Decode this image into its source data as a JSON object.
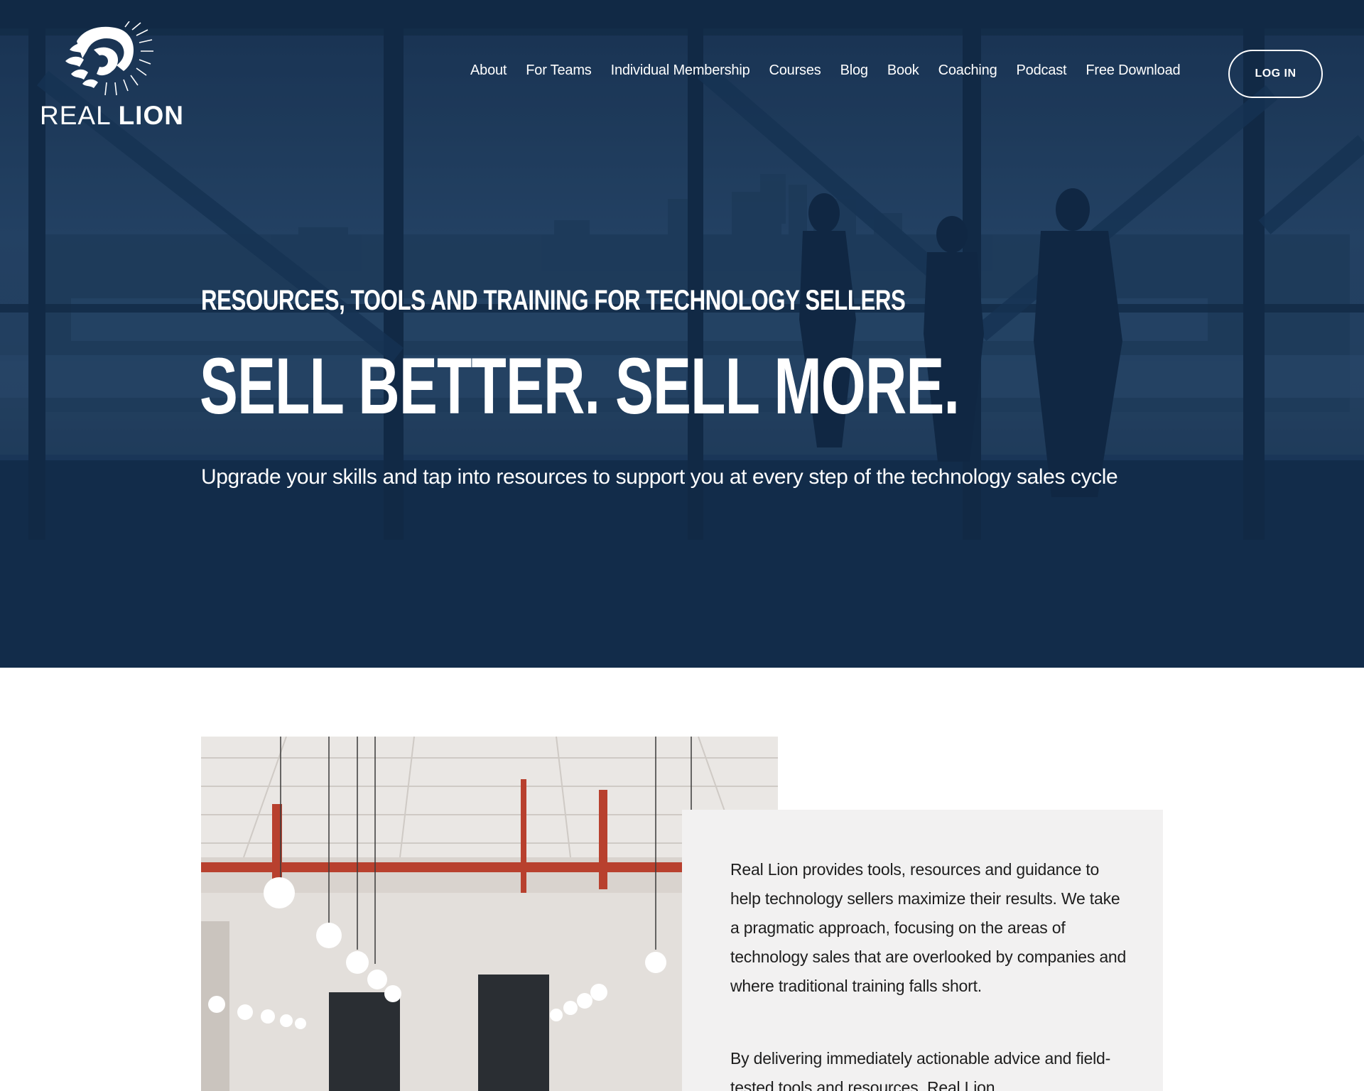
{
  "logo": {
    "word_light": "REAL",
    "word_bold": "LION",
    "icon": "lion-head-icon"
  },
  "nav": {
    "items": [
      {
        "label": "About"
      },
      {
        "label": "For Teams"
      },
      {
        "label": "Individual Membership"
      },
      {
        "label": "Courses"
      },
      {
        "label": "Blog"
      },
      {
        "label": "Book"
      },
      {
        "label": "Coaching"
      },
      {
        "label": "Podcast"
      },
      {
        "label": "Free Download"
      }
    ],
    "login_label": "LOG IN"
  },
  "hero": {
    "eyebrow": "RESOURCES, TOOLS AND TRAINING FOR TECHNOLOGY SELLERS",
    "headline": "SELL BETTER. SELL MORE.",
    "subhead": "Upgrade your skills and tap into resources to support you at every step of the technology sales cycle"
  },
  "about": {
    "paragraph_1": "Real Lion provides tools, resources and guidance to help technology sellers maximize their results. We take a pragmatic approach, focusing on the areas of technology sales that are overlooked by companies and where traditional training falls short.",
    "paragraph_2": "By delivering immediately actionable advice and field-tested tools and resources, Real Lion"
  },
  "colors": {
    "hero_overlay": "#1c3656",
    "card_background": "#f2f1f1",
    "pipe_red": "#b8402e"
  }
}
